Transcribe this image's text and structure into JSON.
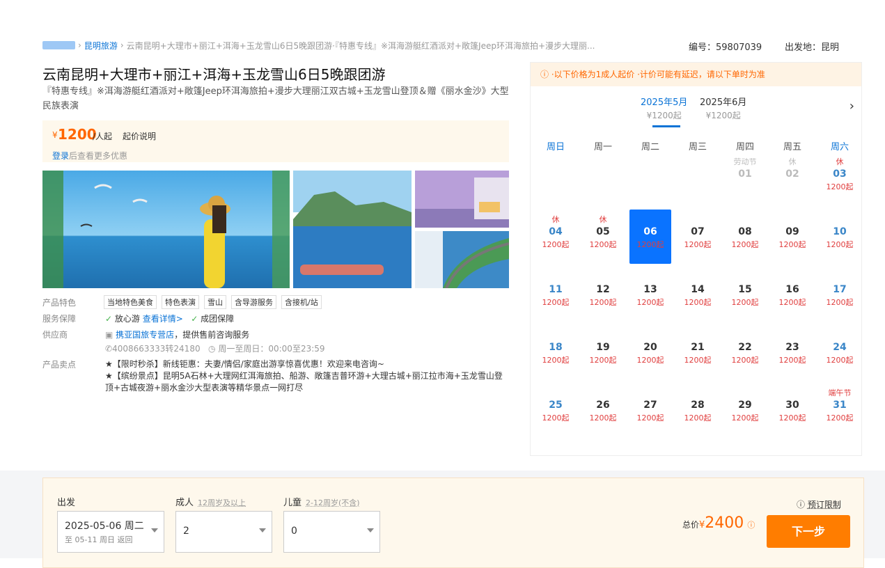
{
  "breadcrumb": {
    "city": "昆明旅游",
    "product": "云南昆明+大理市+丽江+洱海+玉龙雪山6日5晚跟团游·『特惠专线』※洱海游艇红酒派对+敞篷Jeep环洱海旅拍+漫步大理丽..."
  },
  "meta": {
    "id_label": "编号：",
    "id": "59807039",
    "depart_label": "出发地：",
    "depart": "昆明"
  },
  "title": "云南昆明+大理市+丽江+洱海+玉龙雪山6日5晚跟团游",
  "subtitle": "『特惠专线』※洱海游艇红酒派对+敞篷Jeep环洱海旅拍+漫步大理丽江双古城+玉龙雪山登顶＆赠《丽水金沙》大型民族表演",
  "price": {
    "currency": "¥",
    "amount": "1200",
    "unit": "/人起",
    "note": "起价说明",
    "login": "登录",
    "login_rest": "后查看更多优惠"
  },
  "features": {
    "label": "产品特色",
    "tags": [
      "当地特色美食",
      "特色表演",
      "雪山",
      "含导游服务",
      "含接机/站"
    ]
  },
  "guarantee": {
    "label": "服务保障",
    "item1": "放心游",
    "link": "查看详情>",
    "item2": "成团保障"
  },
  "supplier": {
    "label": "供应商",
    "name": "携亚国旅专营店",
    "rest": "，提供售前咨询服务",
    "phone": "4008663333转24180",
    "hours": "周一至周日：00:00至23:59"
  },
  "selling": {
    "label": "产品卖点",
    "lines": [
      "★【限时秒杀】新线钜惠：夫妻/情侣/家庭出游享惊喜优惠！欢迎来电咨询~",
      "★【缤纷景点】昆明5A石林+大理网红洱海旅拍、船游、敞篷吉普环游+大理古城+丽江拉市海+玉龙雪山登顶+古城夜游+丽水金沙大型表演等精华景点一网打尽"
    ]
  },
  "calendar": {
    "notice": "ⓘ ·以下价格为1成人起价 ·计价可能有延迟，请以下单时为准",
    "months": [
      {
        "label": "2025年5月",
        "price": "¥1200起"
      },
      {
        "label": "2025年6月",
        "price": "¥1200起"
      }
    ],
    "weekdays": [
      "周日",
      "周一",
      "周二",
      "周三",
      "周四",
      "周五",
      "周六"
    ],
    "days": [
      {
        "d": "01",
        "tag": "劳动节",
        "p": "",
        "col": 4,
        "row": 0,
        "off": true
      },
      {
        "d": "02",
        "tag": "休",
        "p": "",
        "col": 5,
        "row": 0,
        "off": true
      },
      {
        "d": "03",
        "tag": "休",
        "p": "1200起",
        "col": 6,
        "row": 0
      },
      {
        "d": "04",
        "tag": "休",
        "p": "1200起",
        "col": 0,
        "row": 1
      },
      {
        "d": "05",
        "tag": "休",
        "p": "1200起",
        "col": 1,
        "row": 1
      },
      {
        "d": "06",
        "tag": "",
        "p": "1200起",
        "col": 2,
        "row": 1,
        "sel": true
      },
      {
        "d": "07",
        "tag": "",
        "p": "1200起",
        "col": 3,
        "row": 1
      },
      {
        "d": "08",
        "tag": "",
        "p": "1200起",
        "col": 4,
        "row": 1
      },
      {
        "d": "09",
        "tag": "",
        "p": "1200起",
        "col": 5,
        "row": 1
      },
      {
        "d": "10",
        "tag": "",
        "p": "1200起",
        "col": 6,
        "row": 1
      },
      {
        "d": "11",
        "tag": "",
        "p": "1200起",
        "col": 0,
        "row": 2
      },
      {
        "d": "12",
        "tag": "",
        "p": "1200起",
        "col": 1,
        "row": 2
      },
      {
        "d": "13",
        "tag": "",
        "p": "1200起",
        "col": 2,
        "row": 2
      },
      {
        "d": "14",
        "tag": "",
        "p": "1200起",
        "col": 3,
        "row": 2
      },
      {
        "d": "15",
        "tag": "",
        "p": "1200起",
        "col": 4,
        "row": 2
      },
      {
        "d": "16",
        "tag": "",
        "p": "1200起",
        "col": 5,
        "row": 2
      },
      {
        "d": "17",
        "tag": "",
        "p": "1200起",
        "col": 6,
        "row": 2
      },
      {
        "d": "18",
        "tag": "",
        "p": "1200起",
        "col": 0,
        "row": 3
      },
      {
        "d": "19",
        "tag": "",
        "p": "1200起",
        "col": 1,
        "row": 3
      },
      {
        "d": "20",
        "tag": "",
        "p": "1200起",
        "col": 2,
        "row": 3
      },
      {
        "d": "21",
        "tag": "",
        "p": "1200起",
        "col": 3,
        "row": 3
      },
      {
        "d": "22",
        "tag": "",
        "p": "1200起",
        "col": 4,
        "row": 3
      },
      {
        "d": "23",
        "tag": "",
        "p": "1200起",
        "col": 5,
        "row": 3
      },
      {
        "d": "24",
        "tag": "",
        "p": "1200起",
        "col": 6,
        "row": 3
      },
      {
        "d": "25",
        "tag": "",
        "p": "1200起",
        "col": 0,
        "row": 4
      },
      {
        "d": "26",
        "tag": "",
        "p": "1200起",
        "col": 1,
        "row": 4
      },
      {
        "d": "27",
        "tag": "",
        "p": "1200起",
        "col": 2,
        "row": 4
      },
      {
        "d": "28",
        "tag": "",
        "p": "1200起",
        "col": 3,
        "row": 4
      },
      {
        "d": "29",
        "tag": "",
        "p": "1200起",
        "col": 4,
        "row": 4
      },
      {
        "d": "30",
        "tag": "",
        "p": "1200起",
        "col": 5,
        "row": 4
      },
      {
        "d": "31",
        "tag": "端午节",
        "p": "1200起",
        "col": 6,
        "row": 4
      }
    ]
  },
  "booking": {
    "depart_label": "出发",
    "depart_value": "2025-05-06 周二",
    "depart_return": "至 05-11 周日 返回",
    "adult_label": "成人",
    "adult_hint": "12周岁及以上",
    "adult_value": "2",
    "child_label": "儿童",
    "child_hint": "2-12周岁(不含)",
    "child_value": "0",
    "limit": "预订限制",
    "total_label": "总价",
    "total_currency": "¥",
    "total": "2400",
    "next": "下一步"
  }
}
